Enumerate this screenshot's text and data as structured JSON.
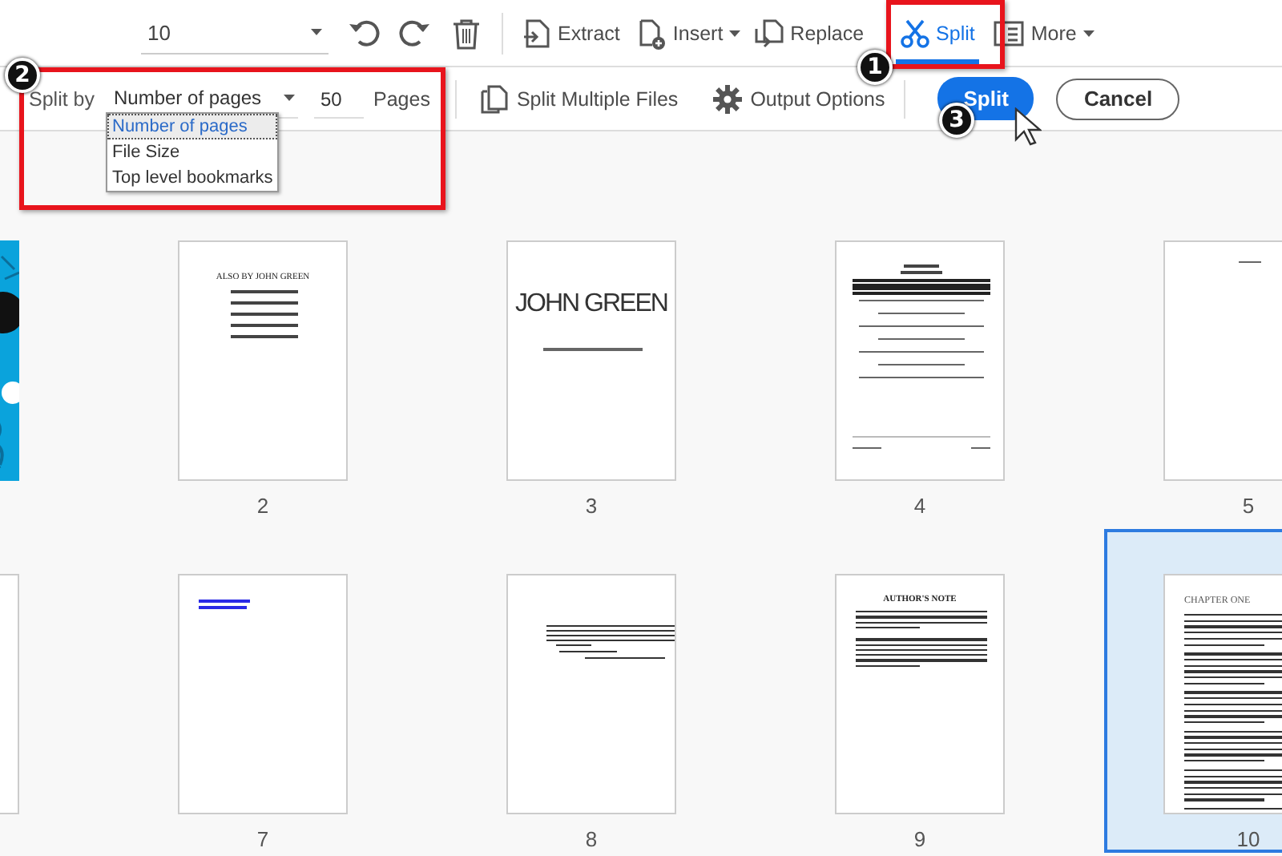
{
  "toolbar": {
    "page_field": {
      "value": "10"
    },
    "tools": [
      {
        "kind": "extract",
        "label": "Extract",
        "has_menu": false,
        "selected": false
      },
      {
        "kind": "insert",
        "label": "Insert",
        "has_menu": true,
        "selected": false
      },
      {
        "kind": "replace",
        "label": "Replace",
        "has_menu": false,
        "selected": false
      },
      {
        "kind": "split",
        "label": "Split",
        "has_menu": false,
        "selected": true
      },
      {
        "kind": "more",
        "label": "More",
        "has_menu": true,
        "selected": false
      }
    ]
  },
  "split_bar": {
    "label": "Split by",
    "select": {
      "value": "Number of pages",
      "expanded": true,
      "options": [
        {
          "label": "Number of pages",
          "selected": true
        },
        {
          "label": "File Size",
          "selected": false
        },
        {
          "label": "Top level bookmarks",
          "selected": false
        }
      ]
    },
    "count_field": {
      "value": "50"
    },
    "unit": "Pages",
    "actions": [
      {
        "kind": "multiple",
        "label": "Split Multiple Files"
      },
      {
        "kind": "options",
        "label": "Output Options"
      }
    ],
    "buttons": [
      {
        "kind": "primary",
        "label": "Split"
      },
      {
        "kind": "secondary",
        "label": "Cancel"
      }
    ]
  },
  "pages": [
    {
      "kind": "cover",
      "selected": false
    },
    {
      "kind": "list",
      "label": "2",
      "heading": "ALSO BY JOHN GREEN",
      "selected": false
    },
    {
      "kind": "title",
      "label": "3",
      "heading": "JOHN GREEN",
      "selected": false
    },
    {
      "kind": "form",
      "label": "4",
      "selected": false
    },
    {
      "kind": "sparse",
      "label": "5",
      "selected": false
    },
    {
      "kind": "blank",
      "selected": false
    },
    {
      "kind": "links",
      "label": "7",
      "selected": false
    },
    {
      "kind": "quote",
      "label": "8",
      "selected": false
    },
    {
      "kind": "note",
      "label": "9",
      "heading": "AUTHOR'S NOTE",
      "selected": false
    },
    {
      "kind": "chapter",
      "label": "10",
      "heading": "CHAPTER ONE",
      "selected": true
    }
  ],
  "callouts": [
    {
      "label": "1"
    },
    {
      "label": "2"
    },
    {
      "label": "3"
    }
  ]
}
